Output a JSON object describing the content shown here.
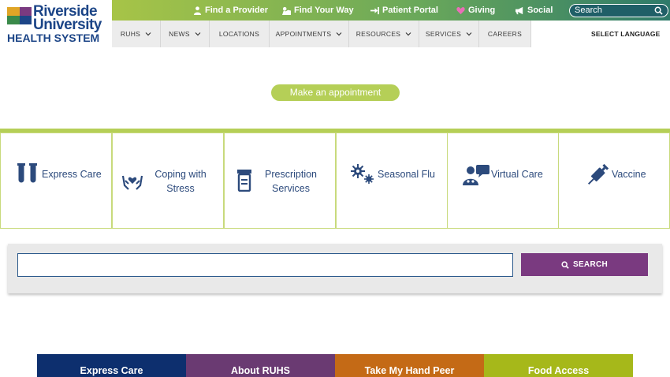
{
  "logo": {
    "line1": "Riverside",
    "line2": "University",
    "line3": "HEALTH SYSTEM"
  },
  "topbar": {
    "links": [
      {
        "label": "Find a Provider",
        "icon": "provider-icon"
      },
      {
        "label": "Find Your Way",
        "icon": "map-icon"
      },
      {
        "label": "Patient Portal",
        "icon": "sign-in-icon"
      },
      {
        "label": "Giving",
        "icon": "heart-icon"
      },
      {
        "label": "Social",
        "icon": "megaphone-icon"
      }
    ],
    "search_placeholder": "Search"
  },
  "nav": {
    "items": [
      {
        "label": "RUHS",
        "dropdown": true
      },
      {
        "label": "NEWS",
        "dropdown": true
      },
      {
        "label": "LOCATIONS",
        "dropdown": false
      },
      {
        "label": "APPOINTMENTS",
        "dropdown": true
      },
      {
        "label": "RESOURCES",
        "dropdown": true
      },
      {
        "label": "SERVICES",
        "dropdown": true
      },
      {
        "label": "CAREERS",
        "dropdown": false
      }
    ],
    "language": "SELECT LANGUAGE"
  },
  "appointment_button": "Make an appointment",
  "tiles": [
    {
      "line1": "Express Care",
      "line2": "",
      "icon": "test-tubes-icon"
    },
    {
      "line1": "Coping with",
      "line2": "Stress",
      "icon": "hands-heart-icon"
    },
    {
      "line1": "Prescription",
      "line2": "Services",
      "icon": "prescription-bottle-icon"
    },
    {
      "line1": "Seasonal Flu",
      "line2": "",
      "icon": "virus-icon"
    },
    {
      "line1": "Virtual Care",
      "line2": "",
      "icon": "doctor-chat-icon"
    },
    {
      "line1": "Vaccine",
      "line2": "",
      "icon": "syringe-icon"
    }
  ],
  "search_panel": {
    "button_label": "SEARCH",
    "input_value": ""
  },
  "bottom_tabs": [
    {
      "label": "Express Care",
      "color": "#0d2f6e"
    },
    {
      "label": "About RUHS",
      "color": "#6a3a72"
    },
    {
      "label": "Take My Hand Peer",
      "color": "#c46a16"
    },
    {
      "label": "Food Access",
      "color": "#a6b81a"
    }
  ],
  "colors": {
    "green": "#b5cf57",
    "navy": "#2c4a7c",
    "purple": "#7a3a80"
  }
}
